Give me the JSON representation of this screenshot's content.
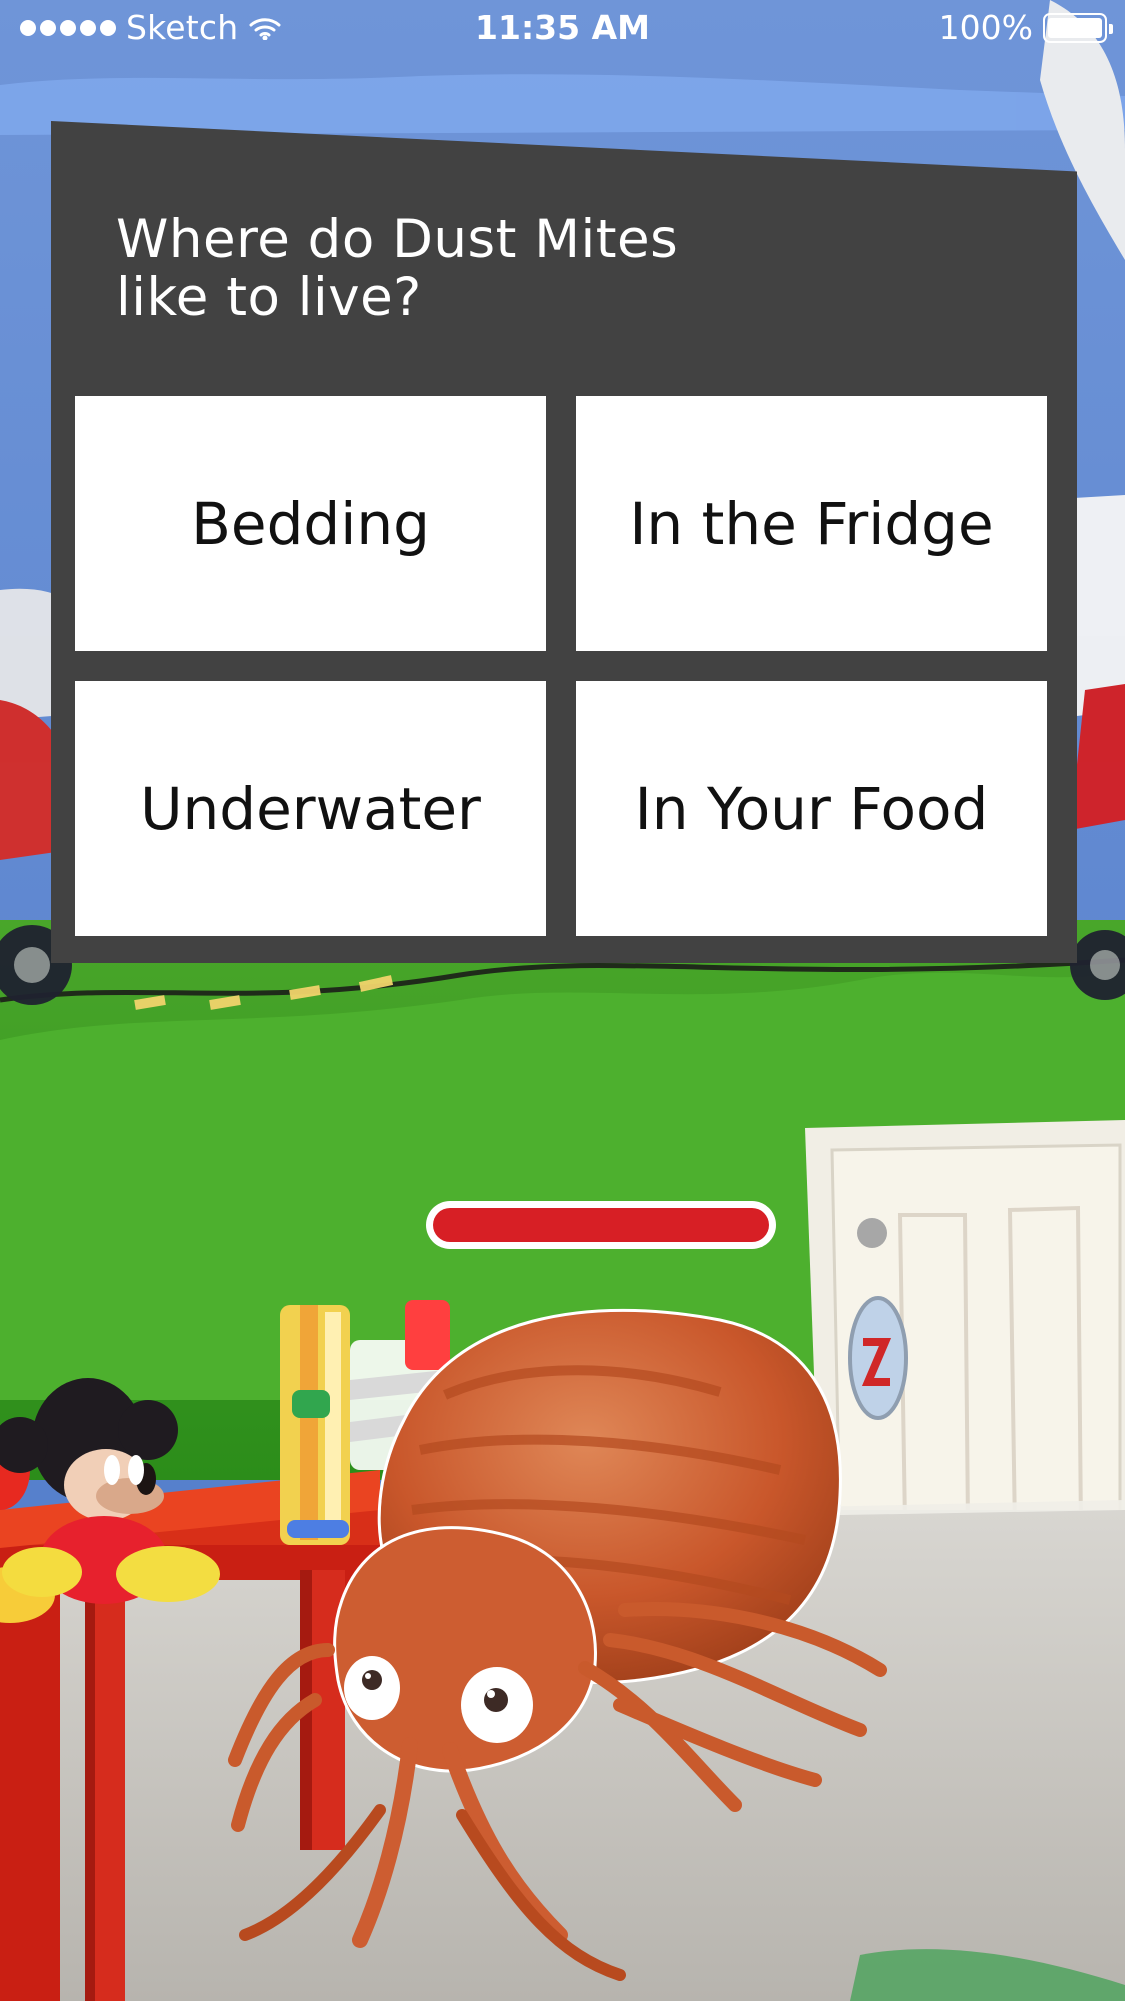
{
  "status_bar": {
    "carrier": "Sketch",
    "time": "11:35 AM",
    "battery_percent": "100%"
  },
  "question": {
    "title_line1": "Where do Dust Mites",
    "title_line2": "like to live?",
    "answers": [
      "Bedding",
      "In the Fridge",
      "Underwater",
      "In Your Food"
    ]
  },
  "progress": {
    "value": 1
  }
}
